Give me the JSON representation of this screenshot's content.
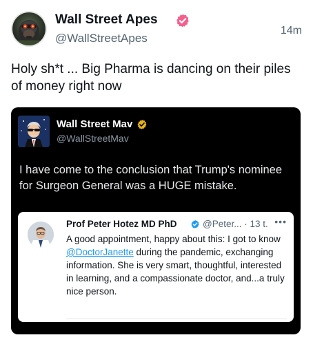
{
  "post": {
    "author_name": "Wall Street Apes",
    "handle": "@WallStreetApes",
    "timestamp": "14m",
    "text": "Holy sh*t ... Big Pharma is dancing on their piles of money right now",
    "avatar_icon": "gorilla-avatar",
    "verified_color": "#f4608c"
  },
  "embedded_post": {
    "author_name": "Wall Street Mav",
    "handle": "@WallStreetMav",
    "text": "I have come to the conclusion that Trump's nominee for Surgeon General was a HUGE mistake.",
    "avatar_icon": "sunglasses-man-avatar",
    "verified_color": "#e8b21d"
  },
  "quoted_post": {
    "author_name": "Prof Peter Hotez MD PhD",
    "handle_time": "@Peter... · 13 t.",
    "more": "•••",
    "text_before": "A good appointment, happy about this: I got to know ",
    "mention": "@DoctorJanette",
    "text_after": " during the pandemic, exchanging information. She is very smart, thoughtful, interested in learning, and a compassionate doctor, and...a truly nice person.",
    "avatar_icon": "doctor-avatar",
    "verified_color": "#1d9bf0"
  }
}
